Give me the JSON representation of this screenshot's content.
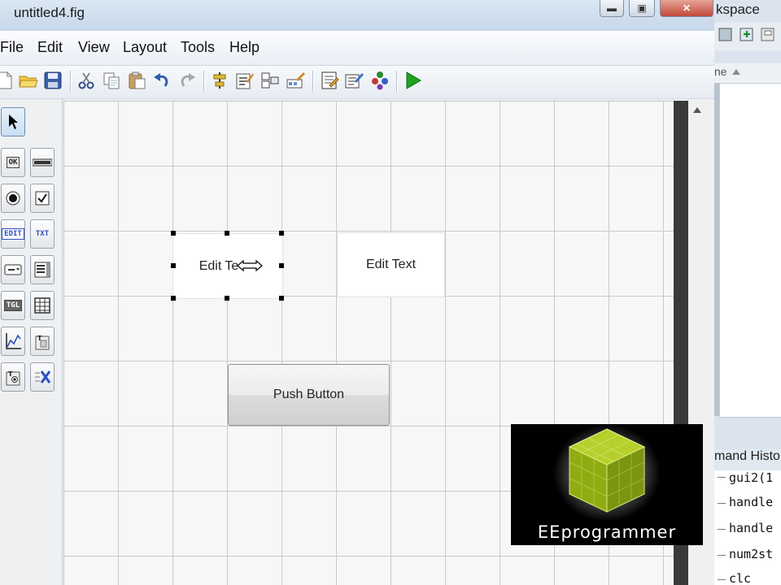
{
  "window": {
    "title": "untitled4.fig",
    "minimize_glyph": "▬",
    "maximize_glyph": "▣",
    "close_glyph": "✕"
  },
  "menu": [
    "File",
    "Edit",
    "View",
    "Layout",
    "Tools",
    "Help"
  ],
  "toolbar": {
    "groups": [
      [
        "new-icon",
        "open-icon",
        "save-icon"
      ],
      [
        "cut-icon",
        "copy-icon",
        "paste-icon",
        "undo-icon",
        "redo-icon"
      ],
      [
        "align-icon",
        "menu-editor-icon",
        "tab-order-icon",
        "toolbar-editor-icon"
      ],
      [
        "editor-icon",
        "property-inspector-icon",
        "object-browser-icon"
      ],
      [
        "run-icon"
      ]
    ]
  },
  "palette": {
    "tools": [
      "select",
      "push-button",
      "slider",
      "radio-button",
      "check-box",
      "edit-text",
      "static-text",
      "popup-menu",
      "listbox",
      "toggle-button",
      "table",
      "axes",
      "panel",
      "button-group",
      "activex-control"
    ],
    "push_label": "OK",
    "edit_label": "EDIT",
    "text_label": "TXT",
    "toggle_label": "TGL"
  },
  "canvas": {
    "edit_text_1": "Edit Te",
    "edit_text_2": "Edit Text",
    "push_button": "Push Button"
  },
  "logo": {
    "text": "EEprogrammer",
    "color": "#9ab51a"
  },
  "workspace": {
    "title_fragment": "kspace",
    "header_fragment": "ne"
  },
  "command_history": {
    "title_fragment": "mand Histo",
    "lines": [
      "gui2(1",
      "handle",
      "handle",
      "num2st",
      "clc"
    ]
  },
  "colors": {
    "titlebar": "#c6d7ea",
    "grid_line": "#c9c9c9",
    "run_green": "#1fa31f"
  }
}
